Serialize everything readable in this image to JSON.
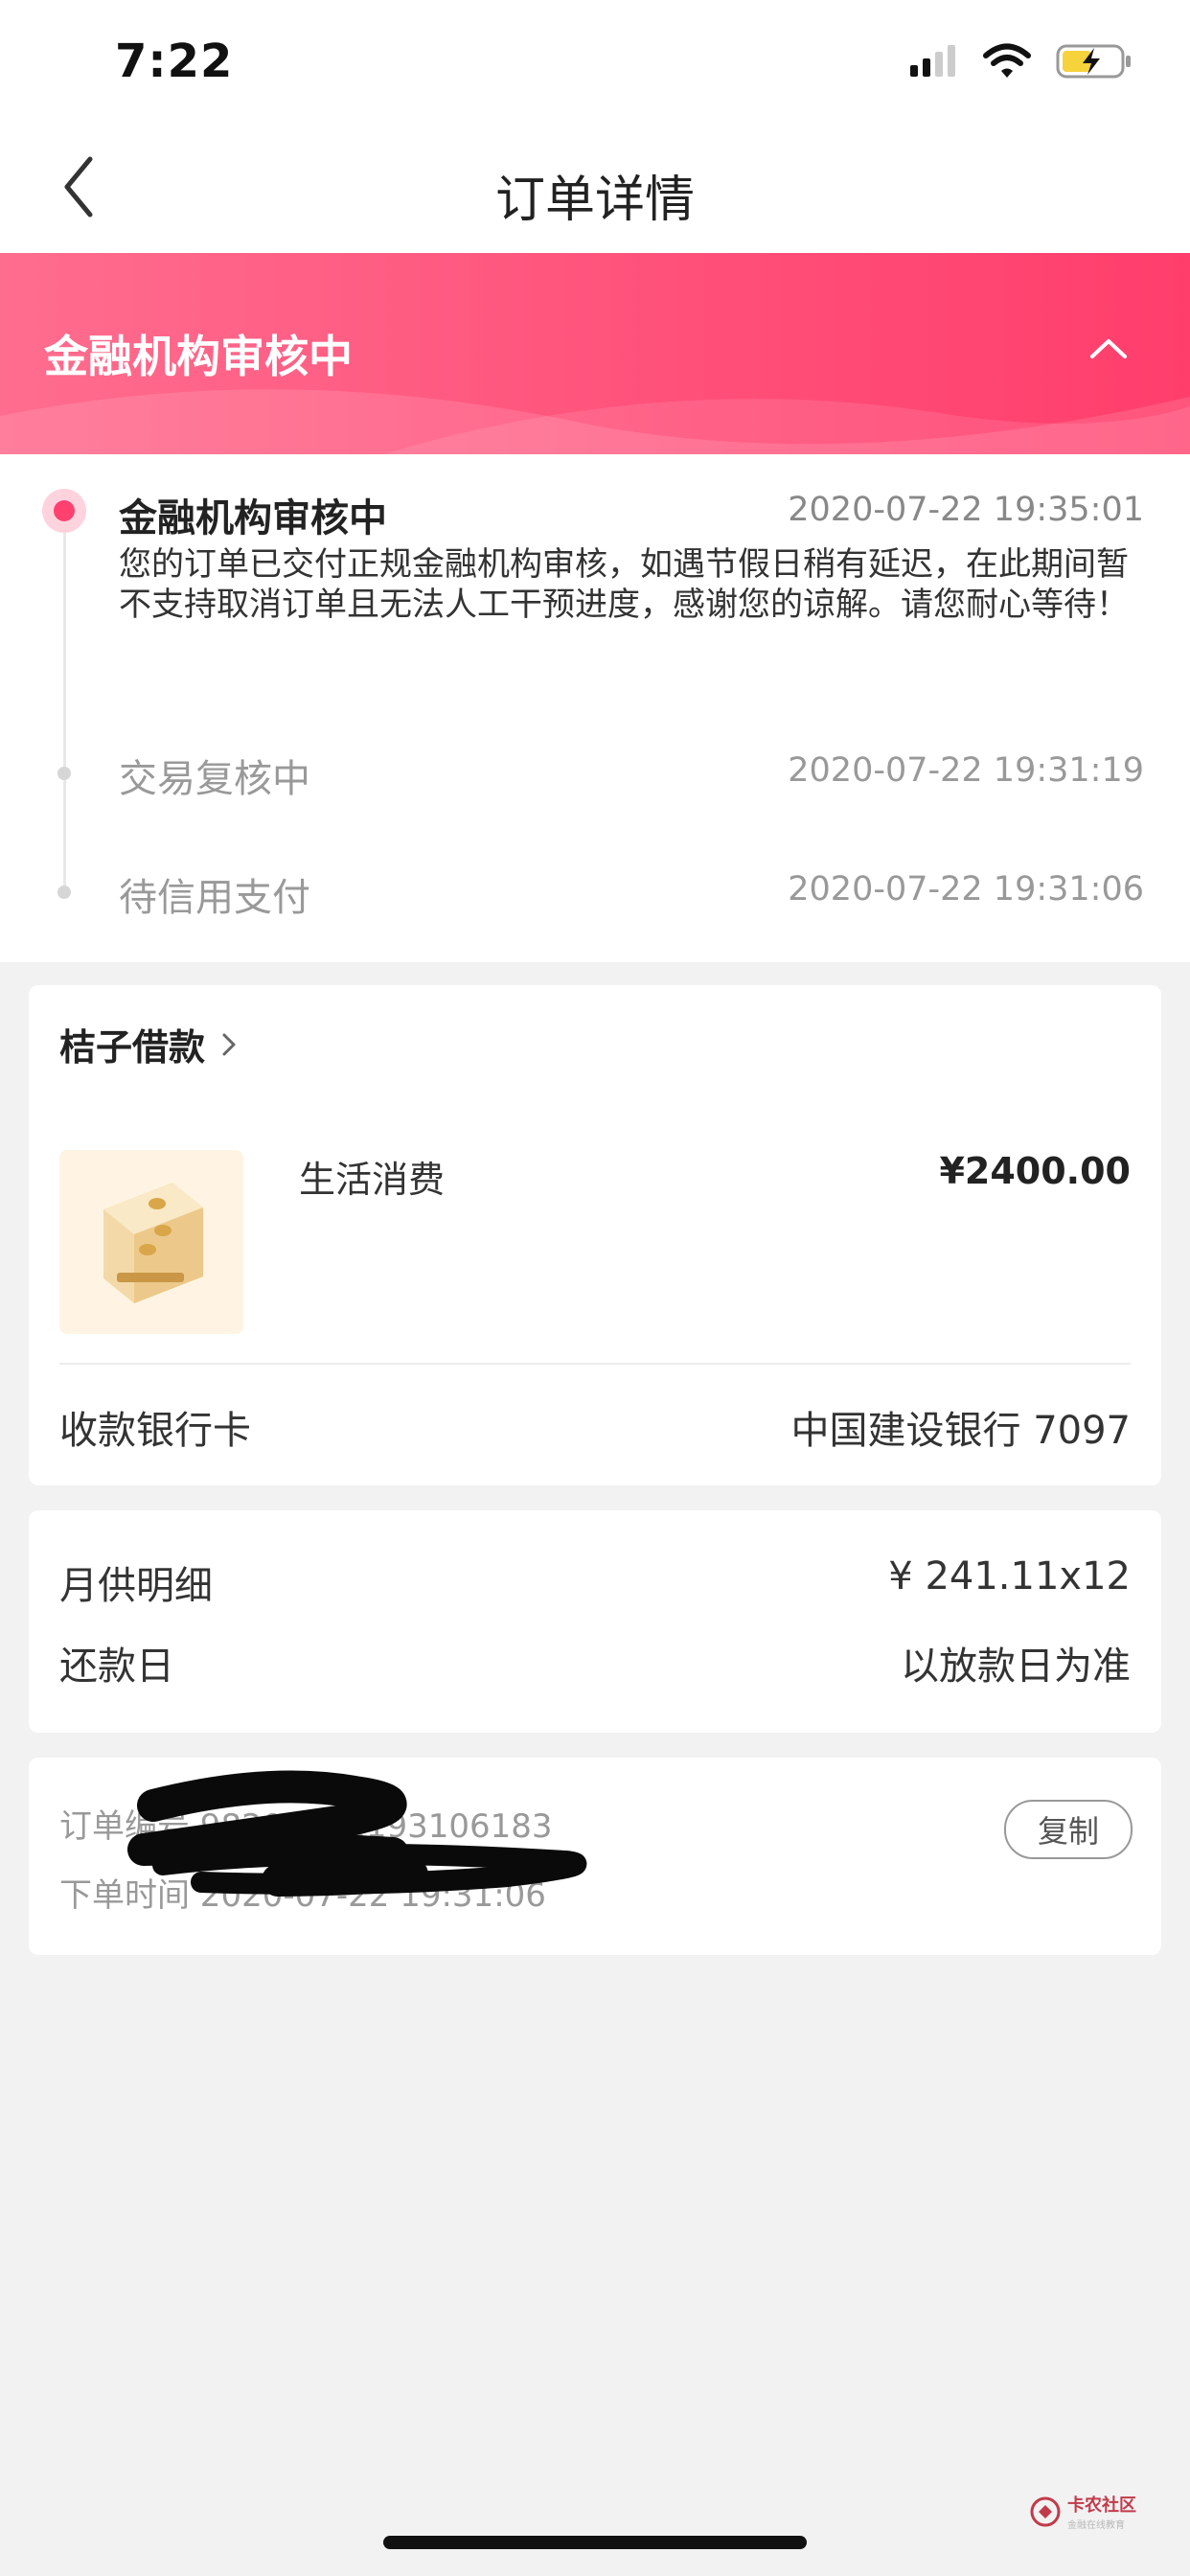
{
  "status_bar": {
    "time": "7:22"
  },
  "nav": {
    "title": "订单详情"
  },
  "banner": {
    "title": "金融机构审核中"
  },
  "timeline": [
    {
      "title": "金融机构审核中",
      "time": "2020-07-22 19:35:01",
      "desc": "您的订单已交付正规金融机构审核，如遇节假日稍有延迟，在此期间暂不支持取消订单且无法人工干预进度，感谢您的谅解。请您耐心等待！"
    },
    {
      "title": "交易复核中",
      "time": "2020-07-22 19:31:19"
    },
    {
      "title": "待信用支付",
      "time": "2020-07-22 19:31:06"
    }
  ],
  "order_card": {
    "lender": "桔子借款",
    "product_name": "生活消费",
    "amount": "¥2400.00",
    "bank_label": "收款银行卡",
    "bank_value": "中国建设银行 7097"
  },
  "repay_card": {
    "monthly_label": "月供明细",
    "monthly_value": "¥ 241.11x12",
    "date_label": "还款日",
    "date_value": "以放款日为准"
  },
  "meta_card": {
    "order_no": "订单编号 98200722193106183",
    "order_time": "下单时间 2020-07-22 19:31:06",
    "copy_label": "复制"
  },
  "watermark": {
    "name": "卡农社区",
    "slogan": "金融在线教育"
  },
  "colors": {
    "accent": "#ff4170",
    "banner_start": "#ff6d8e",
    "banner_end": "#ff3e6c"
  }
}
